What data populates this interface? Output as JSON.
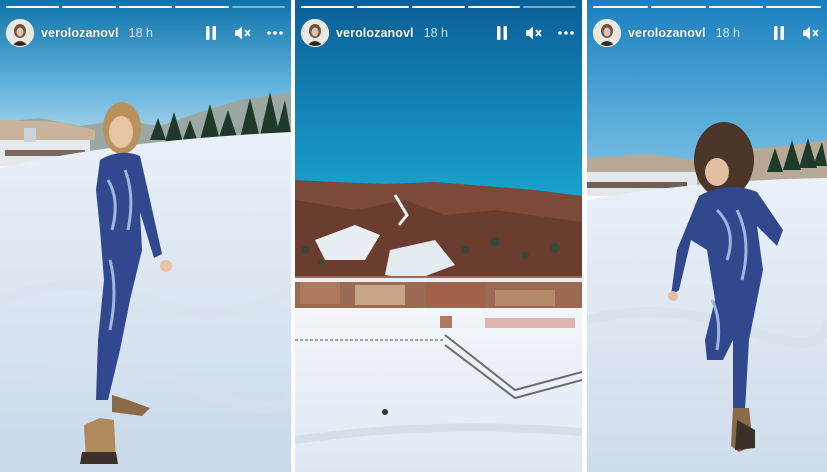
{
  "stories": [
    {
      "username": "verolozanovl",
      "time": "18 h"
    },
    {
      "username": "verolozanovl",
      "time": "18 h"
    },
    {
      "username": "verolozanovl",
      "time": "18 h"
    }
  ],
  "icons": {
    "pause": "pause-icon",
    "mute": "volume-muted-icon",
    "more": "more-options-icon",
    "avatar": "profile-avatar"
  },
  "colors": {
    "sky_top": "#0f7fba",
    "snow": "#eef3f8",
    "mountain": "#8a5a44",
    "outfit": "#31488f"
  }
}
